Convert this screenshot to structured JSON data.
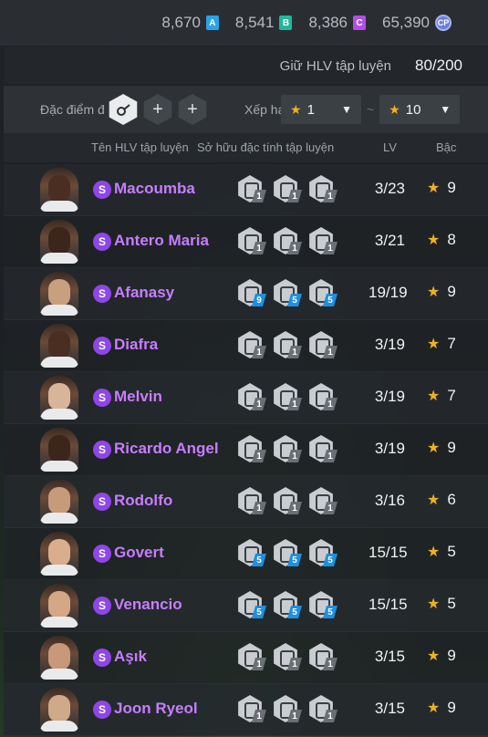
{
  "currency": {
    "a_value": "8,670",
    "a_tag": "A",
    "b_value": "8,541",
    "b_tag": "B",
    "c_value": "8,386",
    "c_tag": "C",
    "coin_value": "65,390",
    "coin_tag": "CP"
  },
  "capacity": {
    "label": "Giữ HLV tập luyện",
    "value": "80/200"
  },
  "filter": {
    "trait_label": "Đặc điểm đ",
    "rank_label": "Xếp hạ",
    "rank_min": "1",
    "rank_max": "10",
    "add_icon": "+"
  },
  "table": {
    "headers": {
      "name": "Tên HLV tập luyện",
      "traits": "Sở hữu đặc tính tập luyện",
      "lv": "LV",
      "rank": "Bậc"
    },
    "rows": [
      {
        "name": "Macoumba",
        "badge": "S",
        "traits": [
          "1",
          "1",
          "1"
        ],
        "blue": [
          false,
          false,
          false
        ],
        "lv": "3/23",
        "rank": "9",
        "skin": "#4a2e22"
      },
      {
        "name": "Antero Maria",
        "badge": "S",
        "traits": [
          "1",
          "1",
          "1"
        ],
        "blue": [
          false,
          false,
          false
        ],
        "lv": "3/21",
        "rank": "8",
        "skin": "#3c261c"
      },
      {
        "name": "Afanasy",
        "badge": "S",
        "traits": [
          "9",
          "5",
          "5"
        ],
        "blue": [
          true,
          true,
          true
        ],
        "lv": "19/19",
        "rank": "9",
        "skin": "#c9a07e"
      },
      {
        "name": "Diafra",
        "badge": "S",
        "traits": [
          "1",
          "1",
          "1"
        ],
        "blue": [
          false,
          false,
          false
        ],
        "lv": "3/19",
        "rank": "7",
        "skin": "#4a2e22"
      },
      {
        "name": "Melvin",
        "badge": "S",
        "traits": [
          "1",
          "1",
          "1"
        ],
        "blue": [
          false,
          false,
          false
        ],
        "lv": "3/19",
        "rank": "7",
        "skin": "#d7b49a"
      },
      {
        "name": "Ricardo Angel",
        "badge": "S",
        "traits": [
          "1",
          "1",
          "1"
        ],
        "blue": [
          false,
          false,
          false
        ],
        "lv": "3/19",
        "rank": "9",
        "skin": "#3c261c"
      },
      {
        "name": "Rodolfo",
        "badge": "S",
        "traits": [
          "1",
          "1",
          "1"
        ],
        "blue": [
          false,
          false,
          false
        ],
        "lv": "3/16",
        "rank": "6",
        "skin": "#c79a7a"
      },
      {
        "name": "Govert",
        "badge": "S",
        "traits": [
          "5",
          "5",
          "5"
        ],
        "blue": [
          true,
          true,
          true
        ],
        "lv": "15/15",
        "rank": "5",
        "skin": "#d9ae8e"
      },
      {
        "name": "Venancio",
        "badge": "S",
        "traits": [
          "5",
          "5",
          "5"
        ],
        "blue": [
          true,
          true,
          true
        ],
        "lv": "15/15",
        "rank": "5",
        "skin": "#d4a786"
      },
      {
        "name": "Aşık",
        "badge": "S",
        "traits": [
          "1",
          "1",
          "1"
        ],
        "blue": [
          false,
          false,
          false
        ],
        "lv": "3/15",
        "rank": "9",
        "skin": "#c8987a"
      },
      {
        "name": "Joon Ryeol",
        "badge": "S",
        "traits": [
          "1",
          "1",
          "1"
        ],
        "blue": [
          false,
          false,
          false
        ],
        "lv": "3/15",
        "rank": "9",
        "skin": "#cfa988"
      }
    ]
  },
  "colors": {
    "name": "#c77dff",
    "badge": "#8f46e8",
    "star": "#f2b01e",
    "lvl_blue": "#1f8fe0"
  },
  "icons": {
    "filter_trait": "whistle-trait-icon",
    "trait": "trait-hexagon-icon",
    "star": "star-icon",
    "caret": "caret-down-icon"
  }
}
